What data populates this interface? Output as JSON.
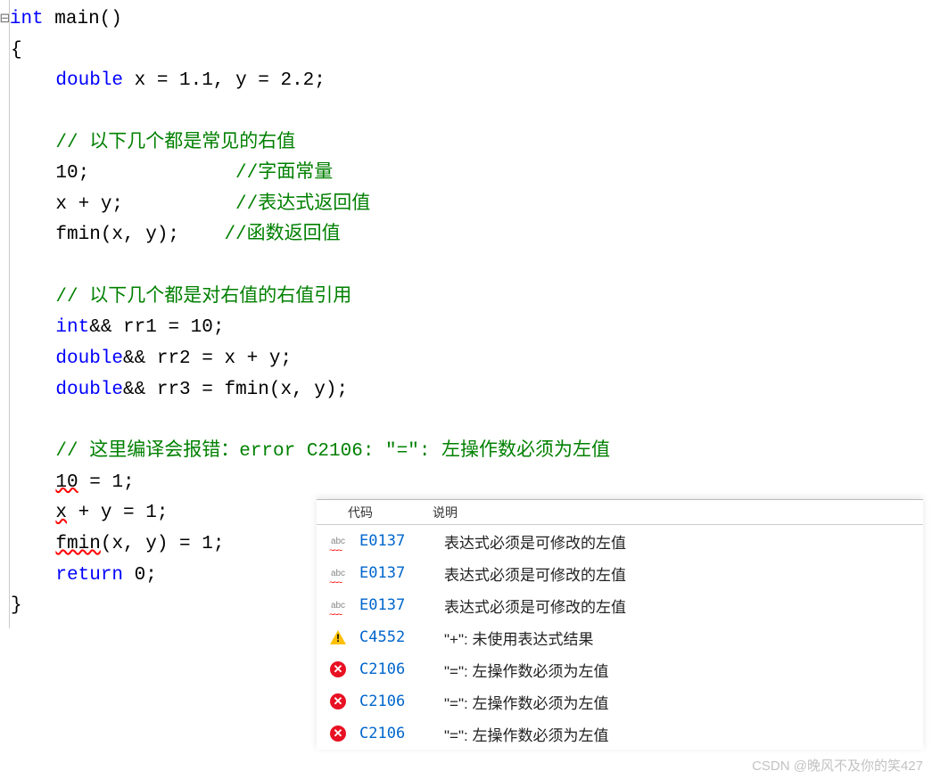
{
  "code": {
    "line1_kw": "int",
    "line1_fn": " main()",
    "line2": "{",
    "line3_a": "    ",
    "line3_kw": "double",
    "line3_b": " x = 1.1, y = 2.2;",
    "line5_cmt": "    // 以下几个都是常见的右值",
    "line6_a": "    10;             ",
    "line6_cmt": "//字面常量",
    "line7_a": "    x + y;          ",
    "line7_cmt": "//表达式返回值",
    "line8_a": "    fmin(x, y);    ",
    "line8_cmt": "//函数返回值",
    "line10_cmt": "    // 以下几个都是对右值的右值引用",
    "line11_a": "    ",
    "line11_kw": "int",
    "line11_b": "&& rr1 = 10;",
    "line12_a": "    ",
    "line12_kw": "double",
    "line12_b": "&& rr2 = x + y;",
    "line13_a": "    ",
    "line13_kw": "double",
    "line13_b": "&& rr3 = fmin(x, y);",
    "line15_cmt": "    // 这里编译会报错：error C2106: \"=\": 左操作数必须为左值",
    "line16_a": "    ",
    "line16_err": "10",
    "line16_b": " = 1;",
    "line17_a": "    ",
    "line17_err": "x",
    "line17_b": " + y = 1;",
    "line18_a": "    ",
    "line18_err": "fmin",
    "line18_b": "(x, y) = 1;",
    "line19_a": "    ",
    "line19_kw": "return",
    "line19_b": " 0;",
    "line20": "}"
  },
  "panel": {
    "header_code": "代码",
    "header_desc": "说明"
  },
  "errors": [
    {
      "type": "abc",
      "code": "E0137",
      "desc": "表达式必须是可修改的左值"
    },
    {
      "type": "abc",
      "code": "E0137",
      "desc": "表达式必须是可修改的左值"
    },
    {
      "type": "abc",
      "code": "E0137",
      "desc": "表达式必须是可修改的左值"
    },
    {
      "type": "warn",
      "code": "C4552",
      "desc": "\"+\": 未使用表达式结果"
    },
    {
      "type": "err",
      "code": "C2106",
      "desc": "\"=\": 左操作数必须为左值"
    },
    {
      "type": "err",
      "code": "C2106",
      "desc": "\"=\": 左操作数必须为左值"
    },
    {
      "type": "err",
      "code": "C2106",
      "desc": "\"=\": 左操作数必须为左值"
    }
  ],
  "watermark": "CSDN @晚风不及你的笑427"
}
